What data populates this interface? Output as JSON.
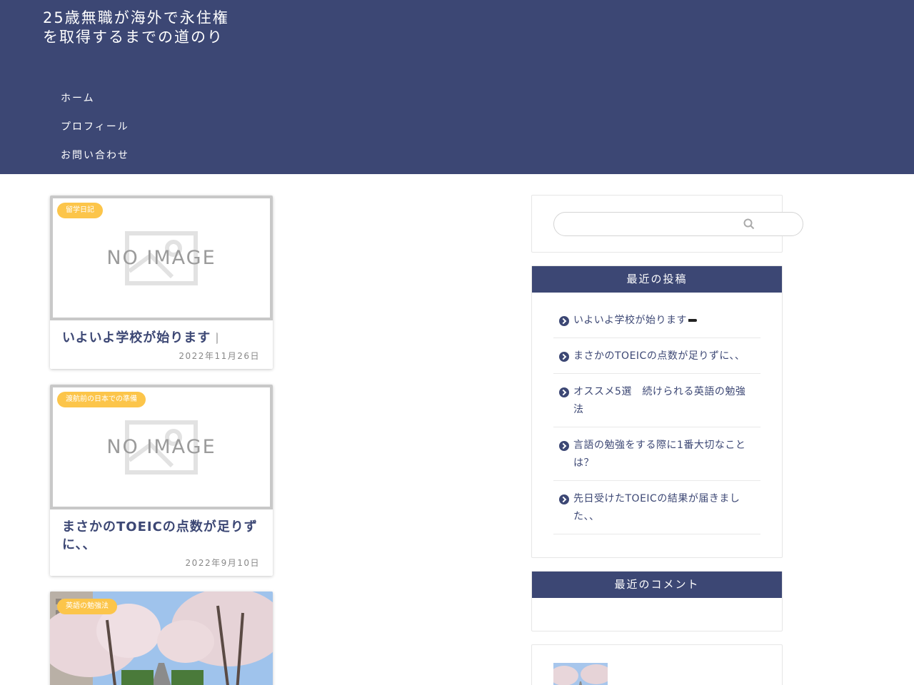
{
  "site": {
    "title": "25歳無職が海外で永住権を取得するまでの道のり"
  },
  "nav": {
    "items": [
      "ホーム",
      "プロフィール",
      "お問い合わせ"
    ]
  },
  "posts": [
    {
      "category": "留学日記",
      "title": "いよいよ学校が始ります",
      "date": "2022年11月26日",
      "thumb": "NO IMAGE"
    },
    {
      "category": "渡航前の日本での準備",
      "title": "まさかのTOEICの点数が足りずに、、",
      "date": "2022年9月10日",
      "thumb": "NO IMAGE"
    },
    {
      "category": "英語の勉強法",
      "title": "",
      "date": "",
      "thumb": "photo"
    }
  ],
  "sidebar": {
    "recent_title": "最近の投稿",
    "recent_posts": [
      "いよいよ学校が始ります",
      "まさかのTOEICの点数が足りずに、、",
      "オススメ5選　続けられる英語の勉強法",
      "言語の勉強をする際に1番大切なことは？",
      "先日受けたTOEICの結果が届きました、、"
    ],
    "comments_title": "最近のコメント"
  },
  "colors": {
    "header": "#3c4774",
    "badge": "#fcc54a",
    "accent": "#3c4774"
  }
}
